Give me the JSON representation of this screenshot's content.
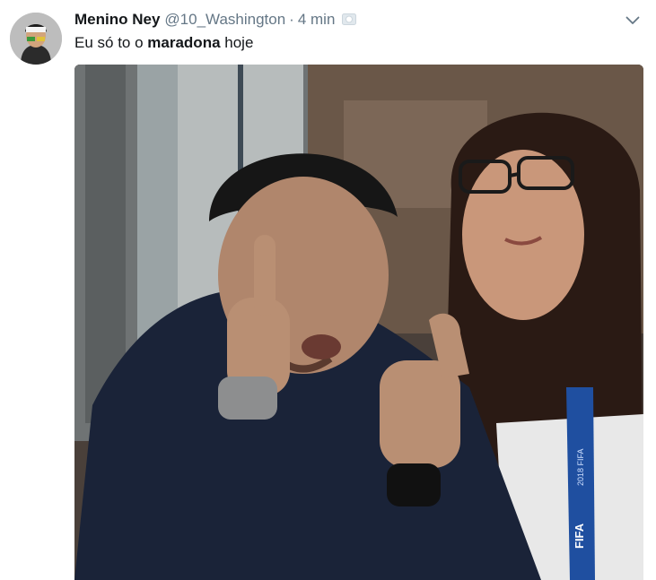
{
  "tweet": {
    "display_name": "Menino Ney",
    "handle": "@10_Washington",
    "separator": "·",
    "timestamp": "4 min",
    "text_prefix": "Eu só to o ",
    "text_bold": "maradona",
    "text_suffix": " hoje"
  },
  "media": {
    "badge_text": "FIFA",
    "lanyard_text": "2018 FIFA"
  },
  "icons": {
    "menu": "chevron-down-icon",
    "badge": "emoji-badge-icon"
  },
  "colors": {
    "name": "#14171a",
    "secondary": "#657786"
  }
}
